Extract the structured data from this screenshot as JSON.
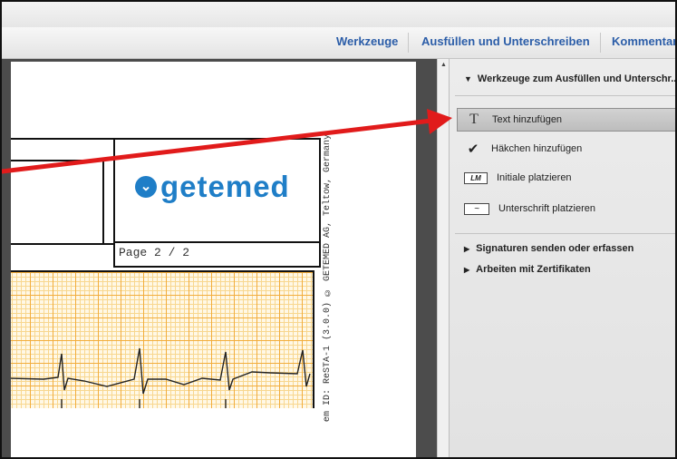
{
  "toolbar": {
    "tools_label": "Werkzeuge",
    "fill_sign_label": "Ausfüllen und Unterschreiben",
    "comment_label": "Kommentar"
  },
  "document": {
    "logo_text": "getemed",
    "page_label": "Page 2 / 2",
    "side_text": "em ID: ReSTA-1 (3.0.0)  © GETEMED AG, Teltow, Germany"
  },
  "panel": {
    "header": "Werkzeuge zum Ausfüllen und Unterschr...",
    "tools": [
      {
        "label": "Text hinzufügen",
        "icon": "text-tool-icon"
      },
      {
        "label": "Häkchen hinzufügen",
        "icon": "checkmark-icon"
      },
      {
        "label": "Initiale platzieren",
        "icon": "initials-icon"
      },
      {
        "label": "Unterschrift platzieren",
        "icon": "signature-icon"
      }
    ],
    "sections": [
      {
        "label": "Signaturen senden oder erfassen"
      },
      {
        "label": "Arbeiten mit Zertifikaten"
      }
    ]
  },
  "colors": {
    "accent_blue": "#2b5da8",
    "arrow_red": "#e11b1b",
    "grid_orange": "#f2ad3c"
  }
}
